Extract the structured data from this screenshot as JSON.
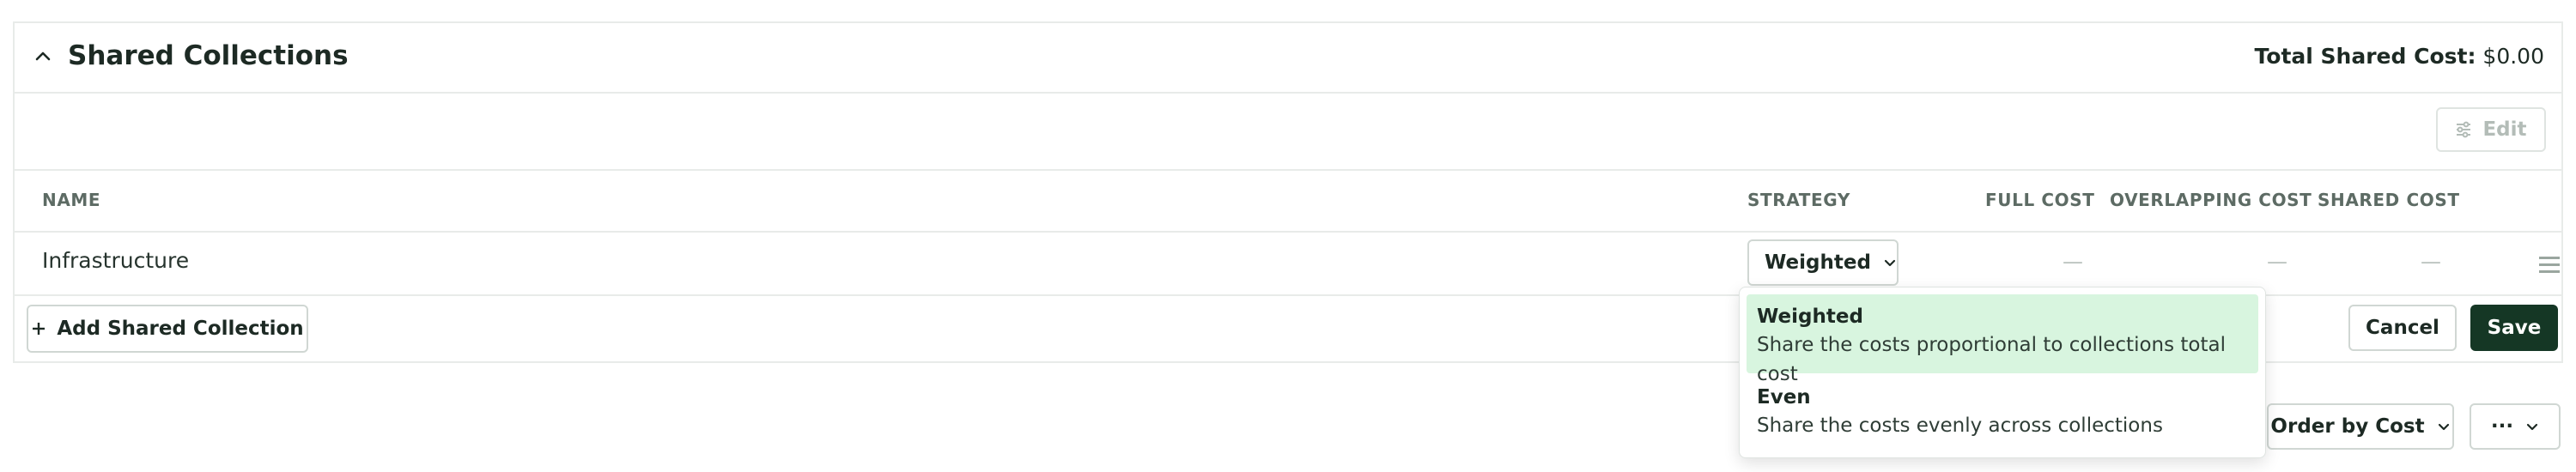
{
  "panel": {
    "title": "Shared Collections",
    "total_label": "Total Shared Cost:",
    "total_value": "$0.00",
    "edit_label": "Edit"
  },
  "table": {
    "headers": {
      "name": "NAME",
      "strategy": "STRATEGY",
      "full_cost": "FULL COST",
      "overlapping_cost": "OVERLAPPING COST",
      "shared_cost": "SHARED COST"
    },
    "rows": [
      {
        "name": "Infrastructure",
        "strategy": "Weighted",
        "full_cost": "—",
        "overlapping_cost": "—",
        "shared_cost": "—"
      }
    ]
  },
  "footer": {
    "add_label": "Add Shared Collection",
    "cancel_label": "Cancel",
    "save_label": "Save"
  },
  "strategy_menu": {
    "options": [
      {
        "title": "Weighted",
        "description": "Share the costs proportional to collections total cost",
        "selected": true
      },
      {
        "title": "Even",
        "description": "Share the costs evenly across collections",
        "selected": false
      }
    ]
  },
  "toolbar": {
    "order_label": "Order by Cost",
    "more_label": "···"
  },
  "colors": {
    "primary": "#153725",
    "selected_bg": "#d8f5df",
    "border": "#e8ebe9",
    "text": "#1d2a24"
  }
}
